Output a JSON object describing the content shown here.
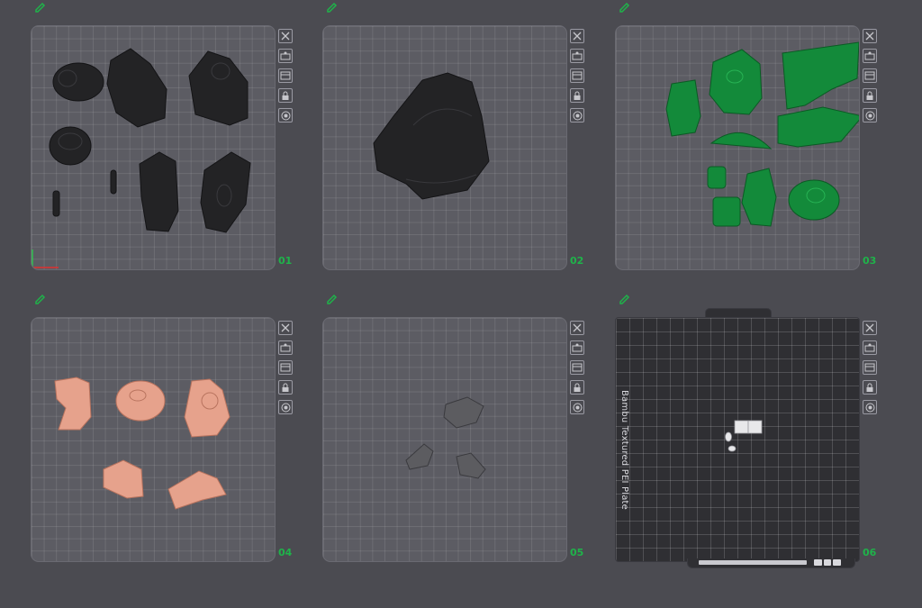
{
  "plates": [
    {
      "number": "01",
      "filament_color": "#232325"
    },
    {
      "number": "02",
      "filament_color": "#232325"
    },
    {
      "number": "03",
      "filament_color": "#138a3a"
    },
    {
      "number": "04",
      "filament_color": "#e6a28c"
    },
    {
      "number": "05",
      "filament_color": "#5c5c60"
    },
    {
      "number": "06",
      "filament_color": "#e8e8ea",
      "plate_type": "Bambu Textured PEI Plate"
    }
  ],
  "tool_icons": [
    "close-icon",
    "arrange-icon",
    "layout-icon",
    "lock-icon",
    "settings-icon"
  ],
  "colors": {
    "accent": "#1fb34a",
    "background": "#4b4b51",
    "plate": "#5c5c63",
    "dark_plate": "#2f2f33"
  }
}
